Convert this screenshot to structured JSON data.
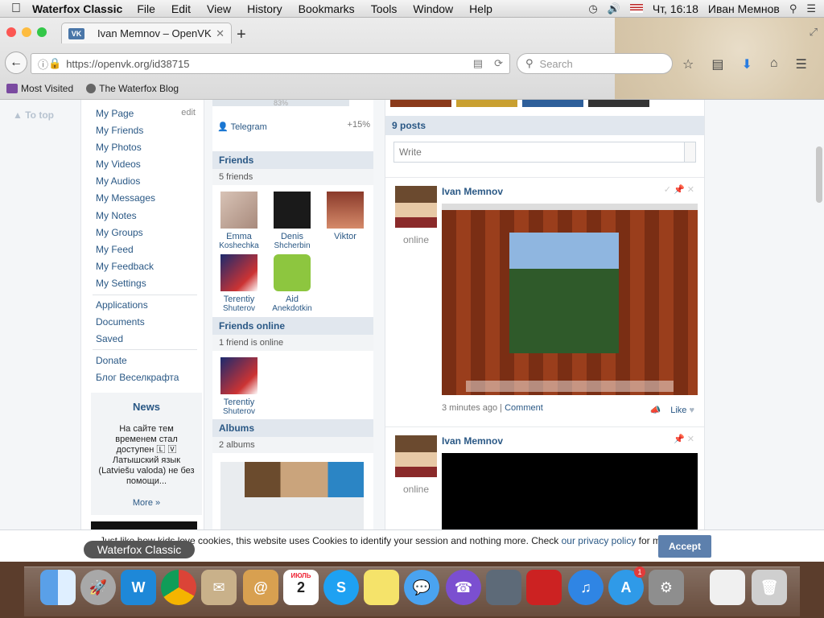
{
  "menubar": {
    "app_name": "Waterfox Classic",
    "items": [
      "File",
      "Edit",
      "View",
      "History",
      "Bookmarks",
      "Tools",
      "Window",
      "Help"
    ],
    "clock": "Чт, 16:18",
    "user": "Иван Мемнов"
  },
  "browser": {
    "tab_title": "Ivan Memnov – OpenVK",
    "url": "https://openvk.org/id38715",
    "search_placeholder": "Search",
    "bookmarks": [
      "Most Visited",
      "The Waterfox Blog"
    ]
  },
  "page": {
    "to_top": "To top",
    "left_menu": {
      "edit_label": "edit",
      "items": [
        "My Page",
        "My Friends",
        "My Photos",
        "My Videos",
        "My Audios",
        "My Messages",
        "My Notes",
        "My Groups",
        "My Feed",
        "My Feedback",
        "My Settings"
      ],
      "items2": [
        "Applications",
        "Documents",
        "Saved"
      ],
      "items3": [
        "Donate",
        "Блог Веселкрафта"
      ]
    },
    "news": {
      "title": "News",
      "text": "На сайте тем временем стал доступен 🄻 🅅 Латышский язык (Latviešu valoda) не без помощи...",
      "more": "More »"
    },
    "profile": {
      "progress_text": "83%",
      "telegram": "Telegram",
      "telegram_value": "+15%",
      "friends_header": "Friends",
      "friends_count": "5 friends",
      "friends": [
        {
          "first": "Emma",
          "last": "Koshechka"
        },
        {
          "first": "Denis",
          "last": "Shcherbin"
        },
        {
          "first": "Viktor",
          "last": ""
        },
        {
          "first": "Terentiy",
          "last": "Shuterov"
        },
        {
          "first": "Aid",
          "last": "Anekdotkin"
        }
      ],
      "online_header": "Friends online",
      "online_count": "1 friend is online",
      "online_friend": {
        "first": "Terentiy",
        "last": "Shuterov"
      },
      "albums_header": "Albums",
      "albums_count": "2 albums"
    },
    "wall": {
      "posts_count": "9 posts",
      "write_placeholder": "Write",
      "posts": [
        {
          "author": "Ivan Memnov",
          "status": "online",
          "time": "3 minutes ago",
          "comment": "Comment",
          "like": "Like"
        },
        {
          "author": "Ivan Memnov",
          "status": "online"
        }
      ]
    },
    "cookie": {
      "text": "Just like how kids love cookies, this website uses Cookies to identify your session and nothing more. Check",
      "link": "our privacy policy",
      "suffix": "for more",
      "accept": "Accept"
    }
  },
  "dock": {
    "tooltip": "Waterfox Classic",
    "calendar_day": "2",
    "calendar_month": "ИЮЛЬ",
    "appstore_badge": "1"
  }
}
